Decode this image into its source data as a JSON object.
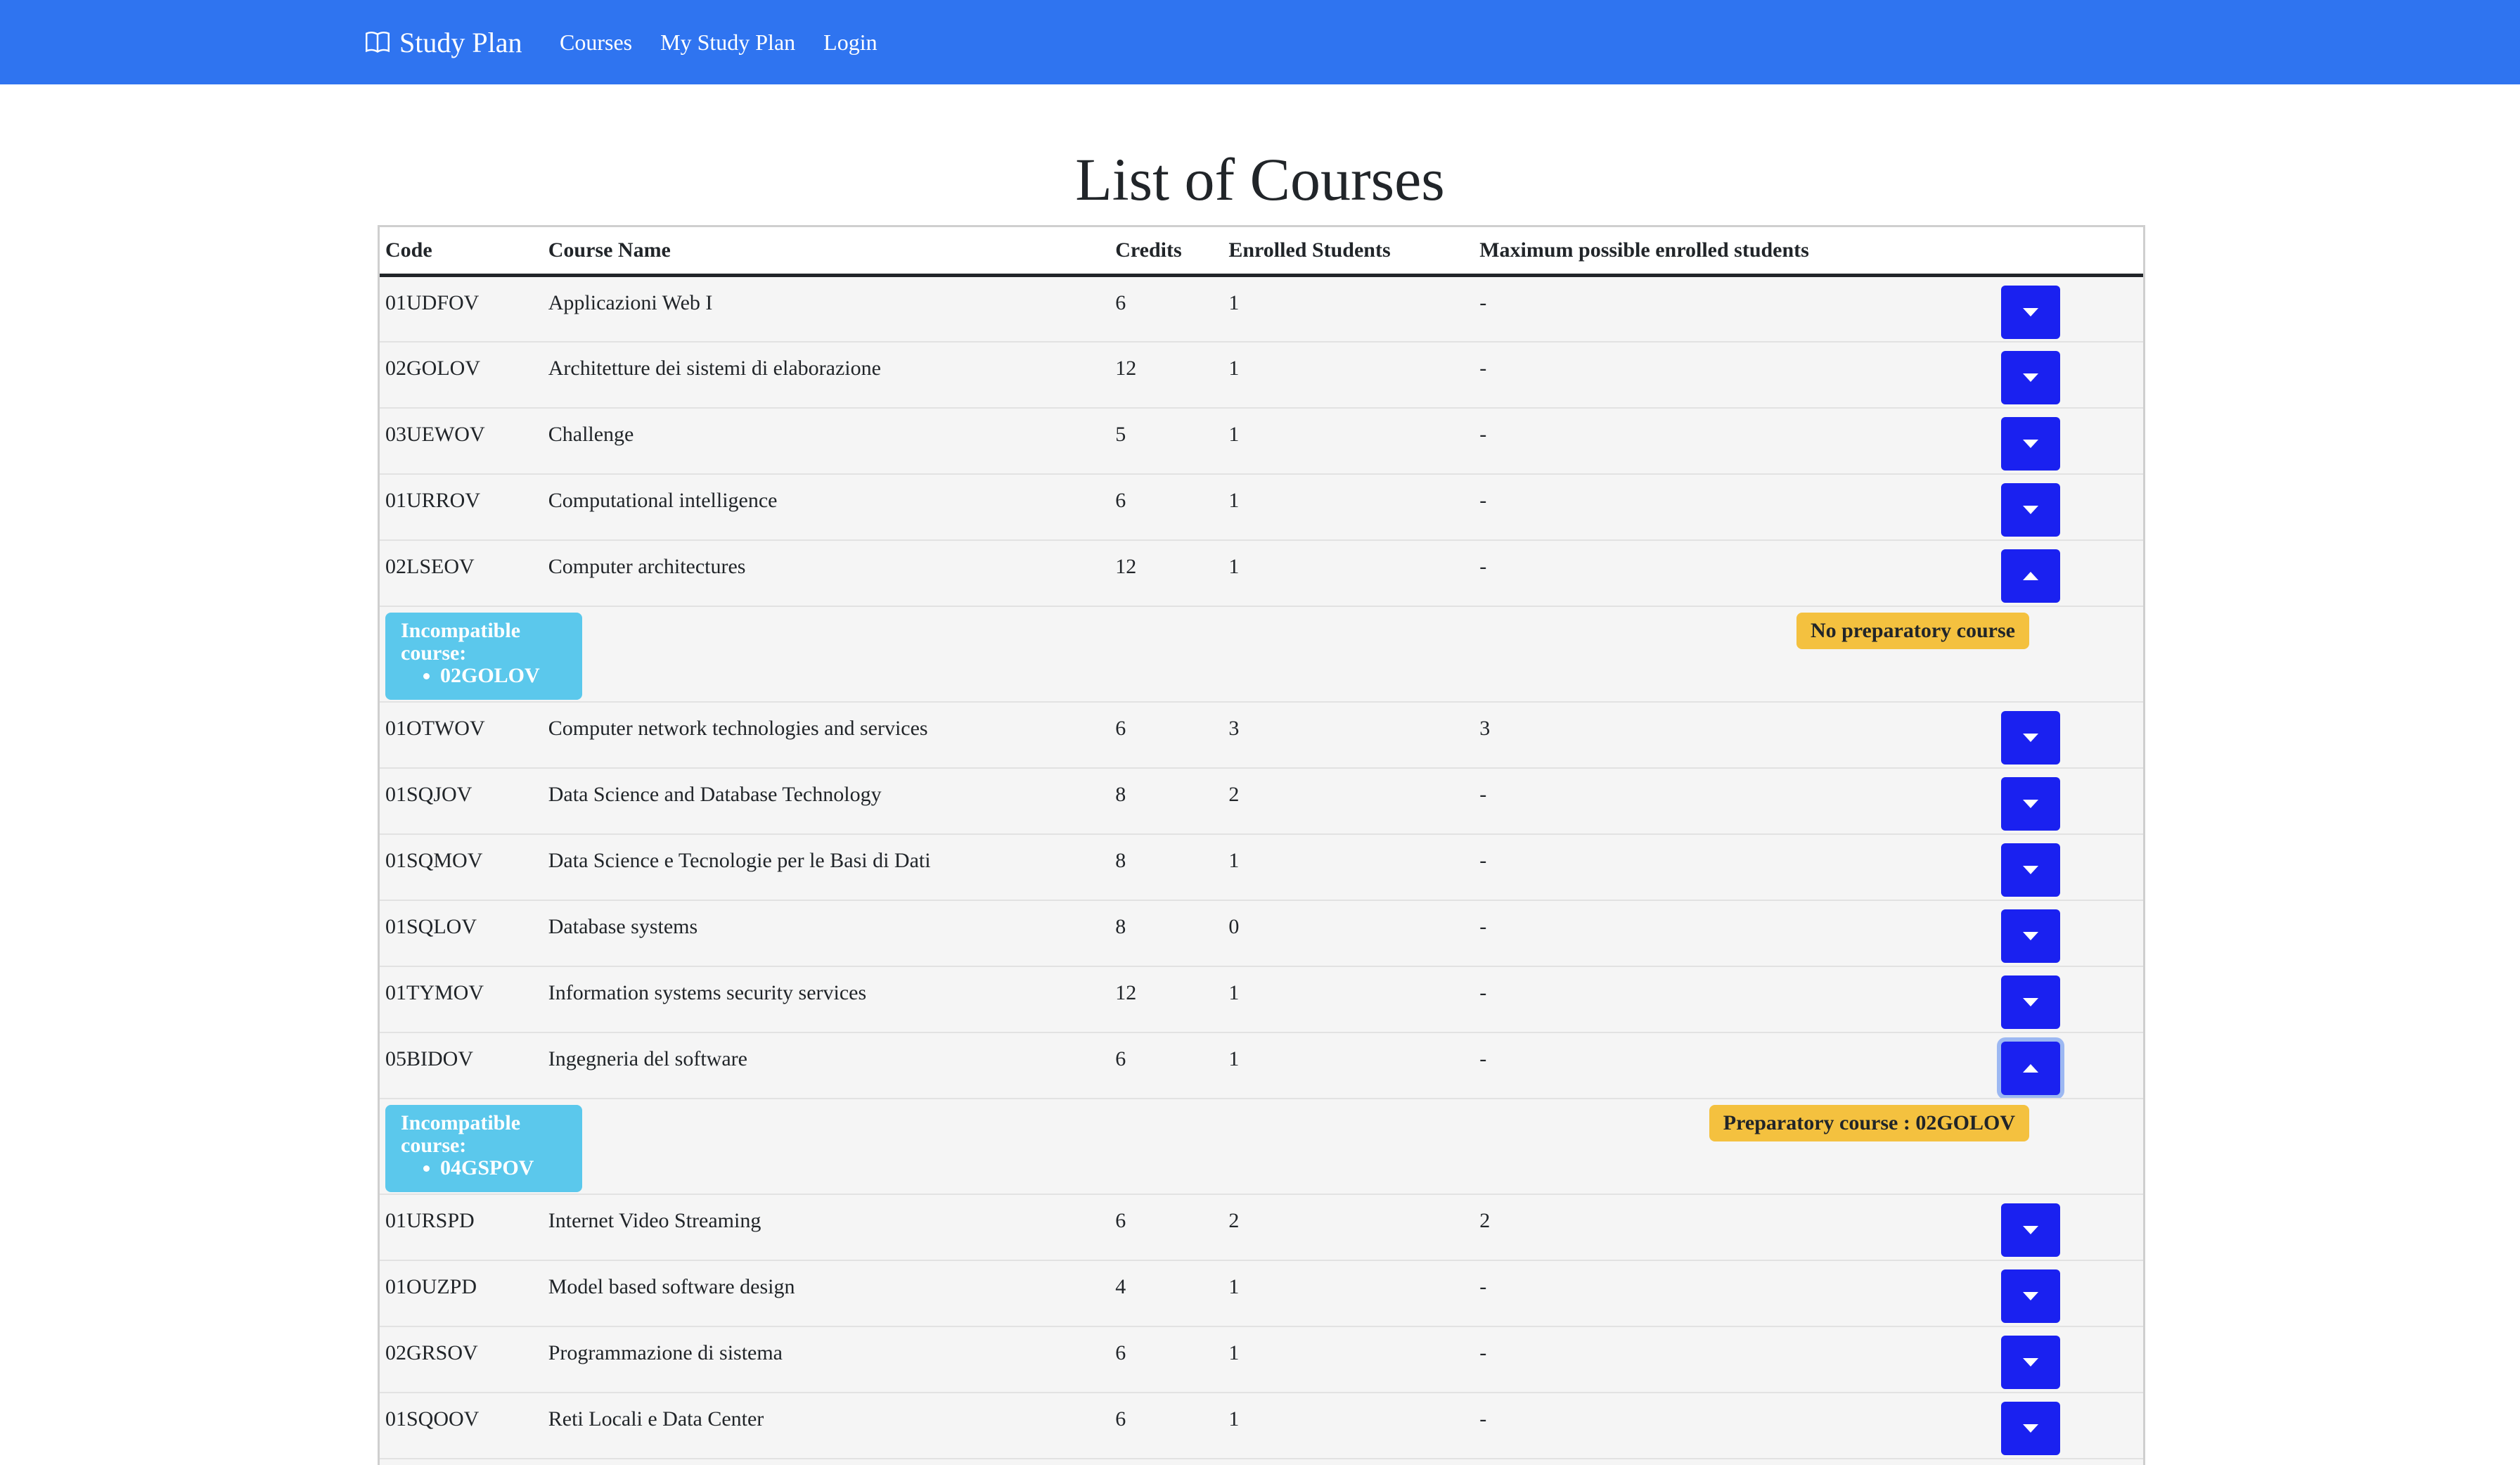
{
  "navbar": {
    "brand": "Study Plan",
    "links": [
      "Courses",
      "My Study Plan",
      "Login"
    ]
  },
  "page": {
    "title": "List of Courses"
  },
  "table": {
    "headers": [
      "Code",
      "Course Name",
      "Credits",
      "Enrolled Students",
      "Maximum possible enrolled students"
    ],
    "rows": [
      {
        "code": "01UDFOV",
        "name": "Applicazioni Web I",
        "credits": "6",
        "enrolled": "1",
        "max": "-"
      },
      {
        "code": "02GOLOV",
        "name": "Architetture dei sistemi di elaborazione",
        "credits": "12",
        "enrolled": "1",
        "max": "-"
      },
      {
        "code": "03UEWOV",
        "name": "Challenge",
        "credits": "5",
        "enrolled": "1",
        "max": "-"
      },
      {
        "code": "01URROV",
        "name": "Computational intelligence",
        "credits": "6",
        "enrolled": "1",
        "max": "-"
      },
      {
        "code": "02LSEOV",
        "name": "Computer architectures",
        "credits": "12",
        "enrolled": "1",
        "max": "-"
      },
      {
        "code": "01OTWOV",
        "name": "Computer network technologies and services",
        "credits": "6",
        "enrolled": "3",
        "max": "3"
      },
      {
        "code": "01SQJOV",
        "name": "Data Science and Database Technology",
        "credits": "8",
        "enrolled": "2",
        "max": "-"
      },
      {
        "code": "01SQMOV",
        "name": "Data Science e Tecnologie per le Basi di Dati",
        "credits": "8",
        "enrolled": "1",
        "max": "-"
      },
      {
        "code": "01SQLOV",
        "name": "Database systems",
        "credits": "8",
        "enrolled": "0",
        "max": "-"
      },
      {
        "code": "01TYMOV",
        "name": "Information systems security services",
        "credits": "12",
        "enrolled": "1",
        "max": "-"
      },
      {
        "code": "05BIDOV",
        "name": "Ingegneria del software",
        "credits": "6",
        "enrolled": "1",
        "max": "-"
      },
      {
        "code": "01URSPD",
        "name": "Internet Video Streaming",
        "credits": "6",
        "enrolled": "2",
        "max": "2"
      },
      {
        "code": "01OUZPD",
        "name": "Model based software design",
        "credits": "4",
        "enrolled": "1",
        "max": "-"
      },
      {
        "code": "02GRSOV",
        "name": "Programmazione di sistema",
        "credits": "6",
        "enrolled": "1",
        "max": "-"
      },
      {
        "code": "01SQOOV",
        "name": "Reti Locali e Data Center",
        "credits": "6",
        "enrolled": "1",
        "max": "-"
      }
    ],
    "details": {
      "computer_architectures": {
        "incompat_label": "Incompatible course:",
        "incompat_item": "02GOLOV",
        "prep_label": "No preparatory course"
      },
      "ingegneria_software": {
        "incompat_label": "Incompatible course:",
        "incompat_item": "04GSPOV",
        "prep_label": "Preparatory course : 02GOLOV"
      }
    }
  },
  "colors": {
    "navbar": "#2f74f0",
    "toggle_button": "#1a21f0",
    "incompat_badge": "#5bc8ec",
    "prep_badge": "#f4c13f"
  },
  "icons": {
    "brand": "book-icon",
    "expand": "caret-down-icon",
    "collapse": "caret-up-icon"
  }
}
